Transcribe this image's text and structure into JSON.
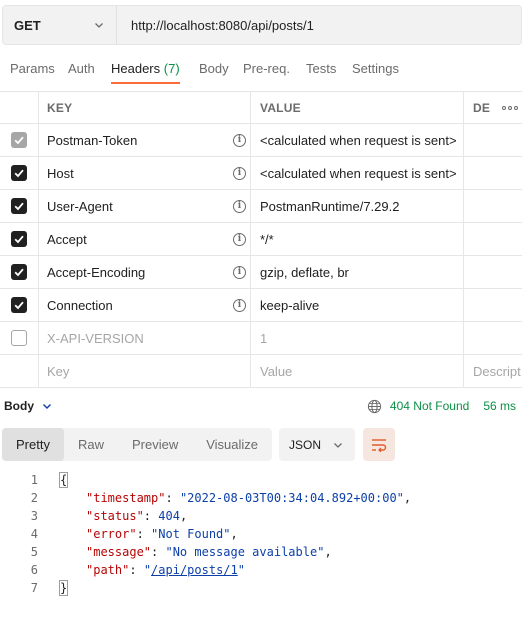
{
  "request": {
    "method": "GET",
    "url": "http://localhost:8080/api/posts/1"
  },
  "tabs": [
    {
      "label": "Params"
    },
    {
      "label": "Auth"
    },
    {
      "label": "Headers",
      "count": "(7)"
    },
    {
      "label": "Body"
    },
    {
      "label": "Pre-req."
    },
    {
      "label": "Tests"
    },
    {
      "label": "Settings"
    }
  ],
  "headers_table": {
    "columns": {
      "key": "KEY",
      "value": "VALUE",
      "description": "DE"
    },
    "rows": [
      {
        "key": "Postman-Token",
        "value": "<calculated when request is sent>",
        "checked": true,
        "disabled": true
      },
      {
        "key": "Host",
        "value": "<calculated when request is sent>",
        "checked": true,
        "disabled": false
      },
      {
        "key": "User-Agent",
        "value": "PostmanRuntime/7.29.2",
        "checked": true,
        "disabled": false
      },
      {
        "key": "Accept",
        "value": "*/*",
        "checked": true,
        "disabled": false
      },
      {
        "key": "Accept-Encoding",
        "value": "gzip, deflate, br",
        "checked": true,
        "disabled": false
      },
      {
        "key": "Connection",
        "value": "keep-alive",
        "checked": true,
        "disabled": false
      },
      {
        "key": "X-API-VERSION",
        "value": "1",
        "checked": false,
        "disabled": false
      }
    ],
    "placeholders": {
      "key": "Key",
      "value": "Value",
      "description": "Descript"
    }
  },
  "response": {
    "section_label": "Body",
    "status": "404 Not Found",
    "time": "56 ms",
    "views": [
      "Pretty",
      "Raw",
      "Preview",
      "Visualize"
    ],
    "active_view": "Pretty",
    "format": "JSON",
    "lines": [
      {
        "n": "1",
        "text": "{"
      },
      {
        "n": "2",
        "key": "\"timestamp\"",
        "val": "\"2022-08-03T00:34:04.892+00:00\"",
        "type": "s",
        "comma": ","
      },
      {
        "n": "3",
        "key": "\"status\"",
        "val": "404",
        "type": "n",
        "comma": ","
      },
      {
        "n": "4",
        "key": "\"error\"",
        "val": "\"Not Found\"",
        "type": "s",
        "comma": ","
      },
      {
        "n": "5",
        "key": "\"message\"",
        "val": "\"No message available\"",
        "type": "s",
        "comma": ","
      },
      {
        "n": "6",
        "key": "\"path\"",
        "val_pre": "\"",
        "val_link": "/api/posts/1",
        "val_post": "\"",
        "type": "link",
        "comma": ""
      },
      {
        "n": "7",
        "text": "}"
      }
    ]
  }
}
